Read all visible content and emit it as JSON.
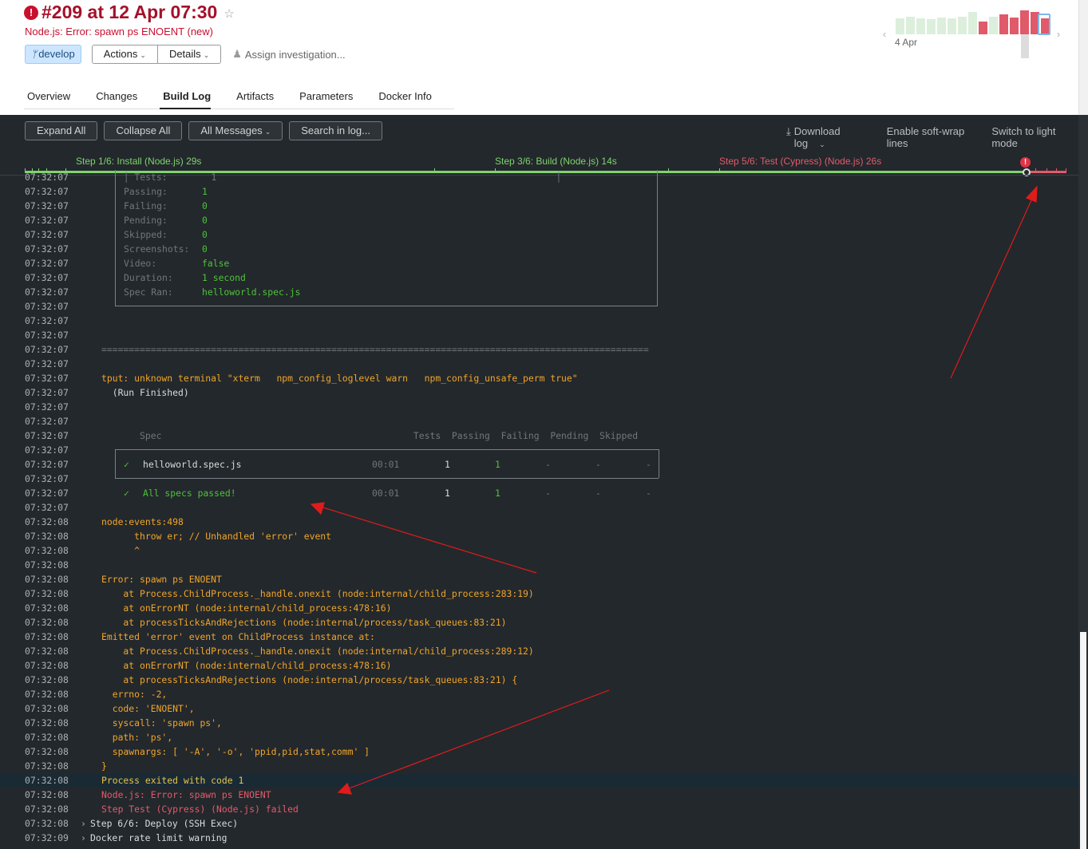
{
  "build": {
    "title": "#209 at 12 Apr 07:30",
    "status": "Node.js: Error: spawn ps ENOENT (new)",
    "branch": "develop",
    "actions_label": "Actions",
    "details_label": "Details",
    "assign_label": "Assign investigation..."
  },
  "history": {
    "date_label": "4 Apr"
  },
  "tabs": [
    "Overview",
    "Changes",
    "Build Log",
    "Artifacts",
    "Parameters",
    "Docker Info"
  ],
  "toolbar": {
    "expand_all": "Expand All",
    "collapse_all": "Collapse All",
    "messages": "All Messages",
    "search": "Search in log...",
    "download": "Download log",
    "soft_wrap": "Enable soft-wrap lines",
    "light_mode": "Switch to light mode"
  },
  "steps": {
    "step1": "Step 1/6: Install (Node.js) 29s",
    "step3": "Step 3/6: Build (Node.js) 14s",
    "step5": "Step 5/6: Test (Cypress) (Node.js) 26s"
  },
  "log": [
    {
      "ts": "07:32:07",
      "text": "  │ Tests:        1                                                              │"
    },
    {
      "ts": "07:32:07",
      "k": "Passing:",
      "v": "1"
    },
    {
      "ts": "07:32:07",
      "k": "Failing:",
      "v": "0"
    },
    {
      "ts": "07:32:07",
      "k": "Pending:",
      "v": "0"
    },
    {
      "ts": "07:32:07",
      "k": "Skipped:",
      "v": "0"
    },
    {
      "ts": "07:32:07",
      "k": "Screenshots:",
      "v": "0"
    },
    {
      "ts": "07:32:07",
      "k": "Video:",
      "v": "false"
    },
    {
      "ts": "07:32:07",
      "k": "Duration:",
      "v": "1 second"
    },
    {
      "ts": "07:32:07",
      "k": "Spec Ran:",
      "v": "helloworld.spec.js"
    },
    {
      "ts": "07:32:07",
      "text": ""
    },
    {
      "ts": "07:32:07",
      "text": ""
    },
    {
      "ts": "07:32:07",
      "text": ""
    },
    {
      "ts": "07:32:07",
      "text": "===================================================================================================="
    },
    {
      "ts": "07:32:07",
      "text": ""
    },
    {
      "ts": "07:32:07",
      "text": "tput: unknown terminal \"xterm   npm_config_loglevel warn   npm_config_unsafe_perm true\""
    },
    {
      "ts": "07:32:07",
      "text": "  (Run Finished)"
    },
    {
      "ts": "07:32:07",
      "text": ""
    },
    {
      "ts": "07:32:07",
      "text": ""
    },
    {
      "ts": "07:32:07",
      "text": "       Spec                                              Tests  Passing  Failing  Pending  Skipped"
    },
    {
      "ts": "07:32:07",
      "text": ""
    },
    {
      "ts": "07:32:07",
      "spec": "helloworld.spec.js",
      "time": "00:01",
      "tests": "1",
      "passing": "1",
      "failing": "-",
      "pending": "-",
      "skipped": "-"
    },
    {
      "ts": "07:32:07",
      "text": ""
    },
    {
      "ts": "07:32:07",
      "spec": "All specs passed!",
      "time": "00:01",
      "tests": "1",
      "passing": "1",
      "failing": "-",
      "pending": "-",
      "skipped": "-"
    },
    {
      "ts": "07:32:07",
      "text": ""
    },
    {
      "ts": "07:32:08",
      "text": "node:events:498"
    },
    {
      "ts": "07:32:08",
      "text": "      throw er; // Unhandled 'error' event"
    },
    {
      "ts": "07:32:08",
      "text": "      ^"
    },
    {
      "ts": "07:32:08",
      "text": ""
    },
    {
      "ts": "07:32:08",
      "text": "Error: spawn ps ENOENT"
    },
    {
      "ts": "07:32:08",
      "text": "    at Process.ChildProcess._handle.onexit (node:internal/child_process:283:19)"
    },
    {
      "ts": "07:32:08",
      "text": "    at onErrorNT (node:internal/child_process:478:16)"
    },
    {
      "ts": "07:32:08",
      "text": "    at processTicksAndRejections (node:internal/process/task_queues:83:21)"
    },
    {
      "ts": "07:32:08",
      "text": "Emitted 'error' event on ChildProcess instance at:"
    },
    {
      "ts": "07:32:08",
      "text": "    at Process.ChildProcess._handle.onexit (node:internal/child_process:289:12)"
    },
    {
      "ts": "07:32:08",
      "text": "    at onErrorNT (node:internal/child_process:478:16)"
    },
    {
      "ts": "07:32:08",
      "text": "    at processTicksAndRejections (node:internal/process/task_queues:83:21) {"
    },
    {
      "ts": "07:32:08",
      "text": "  errno: -2,"
    },
    {
      "ts": "07:32:08",
      "text": "  code: 'ENOENT',"
    },
    {
      "ts": "07:32:08",
      "text": "  syscall: 'spawn ps',"
    },
    {
      "ts": "07:32:08",
      "text": "  path: 'ps',"
    },
    {
      "ts": "07:32:08",
      "text": "  spawnargs: [ '-A', '-o', 'ppid,pid,stat,comm' ]"
    },
    {
      "ts": "07:32:08",
      "text": "}"
    },
    {
      "ts": "07:32:08",
      "text": "Process exited with code 1"
    },
    {
      "ts": "07:32:08",
      "text": "Node.js: Error: spawn ps ENOENT"
    },
    {
      "ts": "07:32:08",
      "text": "Step Test (Cypress) (Node.js) failed"
    },
    {
      "ts": "07:32:08",
      "text": "Step 6/6: Deploy (SSH Exec)"
    },
    {
      "ts": "07:32:09",
      "text": "Docker rate limit warning"
    }
  ]
}
